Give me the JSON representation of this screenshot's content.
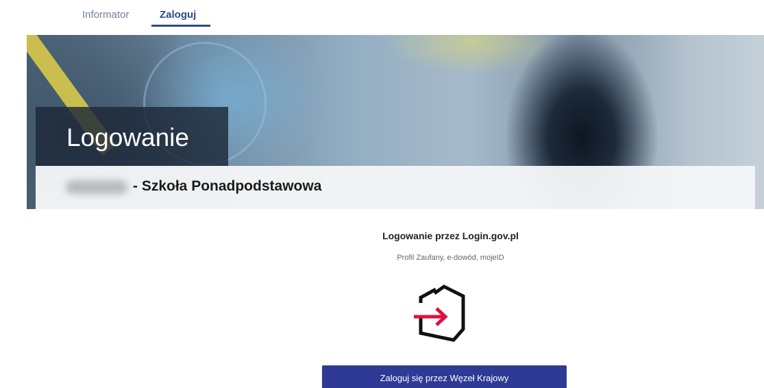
{
  "nav": {
    "tabs": [
      {
        "label": "Informator",
        "active": false
      },
      {
        "label": "Zaloguj",
        "active": true
      }
    ],
    "active_color": "#2d4a82"
  },
  "hero": {
    "title": "Logowanie",
    "school_name": "- Szkoła Ponadpodstawowa"
  },
  "login": {
    "heading": "Logowanie przez Login.gov.pl",
    "subtitle": "Profil Zaufany, e-dowód, mojeID",
    "logo_icon": "login-gov-pl-icon",
    "button_label": "Zaloguj się przez Węzeł Krajowy",
    "button_color": "#2e3a94",
    "arrow_color": "#e0103f"
  }
}
